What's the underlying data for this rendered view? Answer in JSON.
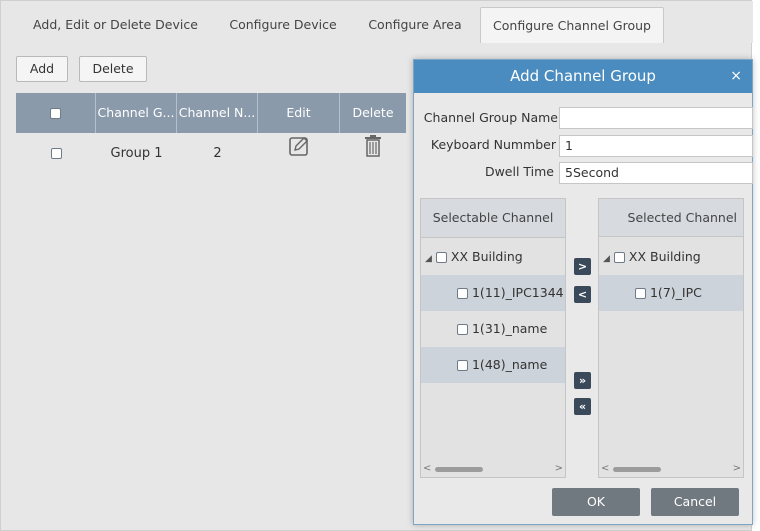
{
  "tabs": [
    {
      "label": "Add, Edit or Delete Device"
    },
    {
      "label": "Configure Device"
    },
    {
      "label": "Configure Area"
    },
    {
      "label": "Configure Channel Group"
    }
  ],
  "active_tab": "Configure Channel Group",
  "toolbar": {
    "add_label": "Add",
    "delete_label": "Delete"
  },
  "table": {
    "headers": [
      "Channel G...",
      "Channel N...",
      "Edit",
      "Delete"
    ],
    "rows": [
      {
        "group": "Group 1",
        "channel_count": "2",
        "edit_icon": "edit-icon",
        "delete_icon": "trash-icon"
      }
    ]
  },
  "dialog": {
    "title": "Add Channel Group",
    "close_glyph": "×",
    "fields": {
      "name_label": "Channel Group Name",
      "name_value": "",
      "keyboard_label": "Keyboard Nummber",
      "keyboard_value": "1",
      "dwell_label": "Dwell Time",
      "dwell_value": "5Second"
    },
    "selectable": {
      "header": "Selectable Channel",
      "root": "XX Building",
      "items": [
        "1(11)_IPC1344",
        "1(31)_name",
        "1(48)_name"
      ]
    },
    "selected": {
      "header": "Selected Channel",
      "root": "XX Building",
      "items": [
        "1(7)_IPC"
      ]
    },
    "move_buttons": {
      "right": ">",
      "left": "<",
      "all_right": "»",
      "all_left": "«"
    },
    "ok_label": "OK",
    "cancel_label": "Cancel"
  },
  "colors": {
    "table_header": "#8a9aab",
    "dialog_header": "#4a8cc0",
    "dialog_button": "#707880",
    "move_button": "#3b4a5a"
  }
}
